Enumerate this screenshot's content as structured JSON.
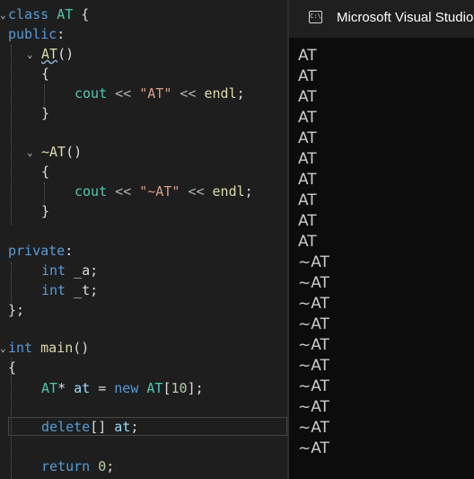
{
  "editor": {
    "lines": [
      {
        "tokens": [
          [
            "kw",
            "class"
          ],
          [
            "id",
            " "
          ],
          [
            "ty",
            "AT"
          ],
          [
            "id",
            " {"
          ]
        ]
      },
      {
        "tokens": [
          [
            "kw",
            "public"
          ],
          [
            "id",
            ":"
          ]
        ]
      },
      {
        "tokens": [
          [
            "fn",
            "AT"
          ],
          [
            "id",
            "()"
          ]
        ]
      },
      {
        "tokens": [
          [
            "id",
            "{"
          ]
        ]
      },
      {
        "tokens": [
          [
            "ty",
            "cout"
          ],
          [
            "id",
            " "
          ],
          [
            "op",
            "<<"
          ],
          [
            "id",
            " "
          ],
          [
            "str",
            "\"AT\""
          ],
          [
            "id",
            " "
          ],
          [
            "op",
            "<<"
          ],
          [
            "id",
            " "
          ],
          [
            "fn",
            "endl"
          ],
          [
            "id",
            ";"
          ]
        ]
      },
      {
        "tokens": [
          [
            "id",
            "}"
          ]
        ]
      },
      {
        "tokens": [
          [
            "fn",
            "~AT"
          ],
          [
            "id",
            "()"
          ]
        ]
      },
      {
        "tokens": [
          [
            "id",
            "{"
          ]
        ]
      },
      {
        "tokens": [
          [
            "ty",
            "cout"
          ],
          [
            "id",
            " "
          ],
          [
            "op",
            "<<"
          ],
          [
            "id",
            " "
          ],
          [
            "str",
            "\"~AT\""
          ],
          [
            "id",
            " "
          ],
          [
            "op",
            "<<"
          ],
          [
            "id",
            " "
          ],
          [
            "fn",
            "endl"
          ],
          [
            "id",
            ";"
          ]
        ]
      },
      {
        "tokens": [
          [
            "id",
            "}"
          ]
        ]
      },
      {
        "tokens": [
          [
            "kw",
            "private"
          ],
          [
            "id",
            ":"
          ]
        ]
      },
      {
        "tokens": [
          [
            "kw",
            "int"
          ],
          [
            "id",
            " _a;"
          ]
        ]
      },
      {
        "tokens": [
          [
            "kw",
            "int"
          ],
          [
            "id",
            " _t;"
          ]
        ]
      },
      {
        "tokens": [
          [
            "id",
            "};"
          ]
        ]
      },
      {
        "tokens": [
          [
            "kw",
            "int"
          ],
          [
            "id",
            " "
          ],
          [
            "fn",
            "main"
          ],
          [
            "id",
            "()"
          ]
        ]
      },
      {
        "tokens": [
          [
            "id",
            "{"
          ]
        ]
      },
      {
        "tokens": [
          [
            "ty",
            "AT"
          ],
          [
            "id",
            "* "
          ],
          [
            "var",
            "at"
          ],
          [
            "id",
            " = "
          ],
          [
            "kw",
            "new"
          ],
          [
            "id",
            " "
          ],
          [
            "ty",
            "AT"
          ],
          [
            "id",
            "["
          ],
          [
            "num",
            "10"
          ],
          [
            "id",
            "];"
          ]
        ]
      },
      {
        "tokens": [
          [
            "kw",
            "delete"
          ],
          [
            "id",
            "[] "
          ],
          [
            "var",
            "at"
          ],
          [
            "id",
            ";"
          ]
        ]
      },
      {
        "tokens": [
          [
            "kw",
            "return"
          ],
          [
            "id",
            " "
          ],
          [
            "num",
            "0"
          ],
          [
            "id",
            ";"
          ]
        ]
      }
    ]
  },
  "terminal": {
    "title": "Microsoft Visual Studio",
    "icon": "console-icon",
    "icon_glyph": "C:\\",
    "output": [
      "AT",
      "AT",
      "AT",
      "AT",
      "AT",
      "AT",
      "AT",
      "AT",
      "AT",
      "AT",
      "~AT",
      "~AT",
      "~AT",
      "~AT",
      "~AT",
      "~AT",
      "~AT",
      "~AT",
      "~AT",
      "~AT"
    ]
  },
  "colors": {
    "keyword": "#569cd6",
    "type": "#4ec9b0",
    "function": "#dcdcaa",
    "string": "#d69d85",
    "number": "#b5cea8",
    "text": "#dcdcdc",
    "variable": "#9cdcfe",
    "console_bg": "#0c0c0c",
    "editor_bg": "#1e1e1e"
  }
}
